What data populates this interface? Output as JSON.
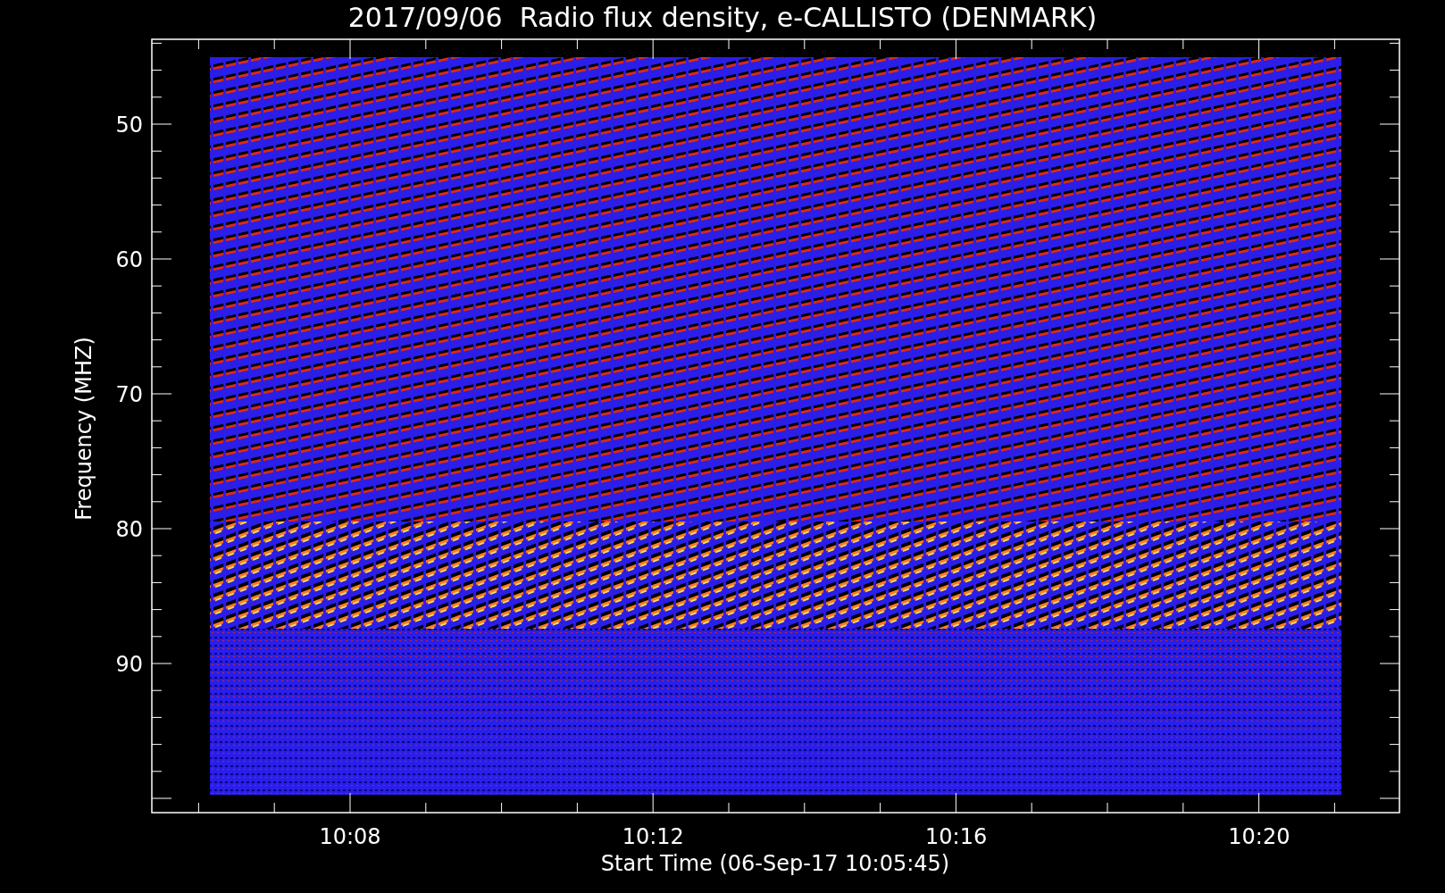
{
  "title": "2017/09/06  Radio flux density, e-CALLISTO (DENMARK)",
  "y_axis": {
    "label": "Frequency (MHZ)",
    "ticks": [
      "50",
      "60",
      "70",
      "80",
      "90"
    ]
  },
  "x_axis": {
    "label": "Start Time (06-Sep-17 10:05:45)",
    "ticks": [
      "10:08",
      "10:12",
      "10:16",
      "10:20"
    ]
  }
}
